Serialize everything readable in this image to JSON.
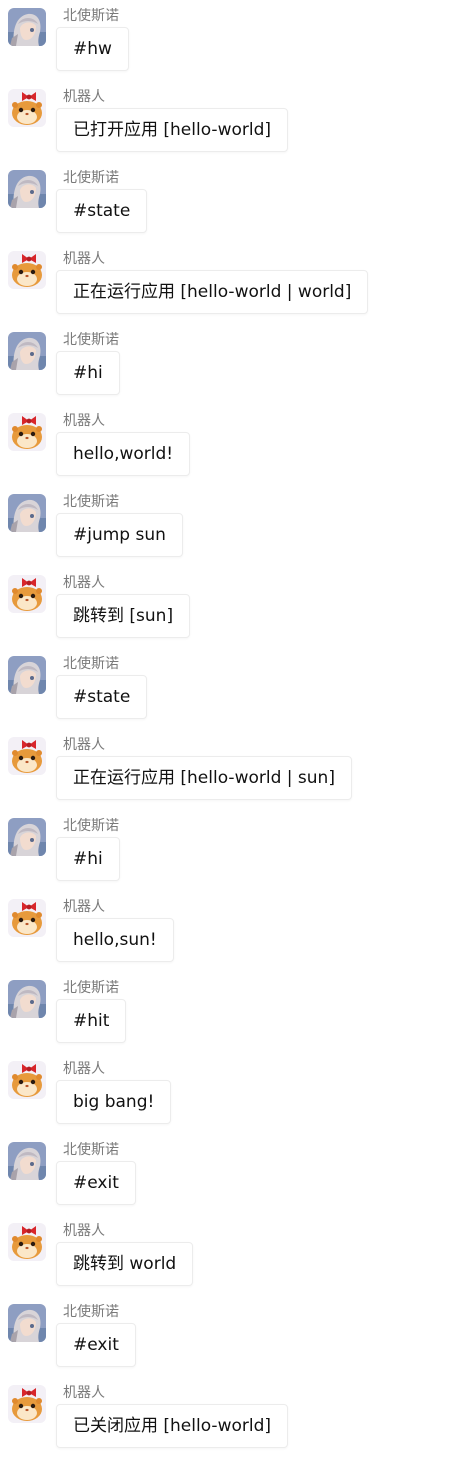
{
  "users": {
    "user": {
      "name": "北使斯诺",
      "avatar_icon": "anime-girl-avatar-icon"
    },
    "bot": {
      "name": "机器人",
      "avatar_icon": "hamster-avatar-icon"
    }
  },
  "messages": [
    {
      "sender": "user",
      "text": "#hw"
    },
    {
      "sender": "bot",
      "text": "已打开应用 [hello-world]"
    },
    {
      "sender": "user",
      "text": "#state"
    },
    {
      "sender": "bot",
      "text": "正在运行应用 [hello-world | world]"
    },
    {
      "sender": "user",
      "text": "#hi"
    },
    {
      "sender": "bot",
      "text": "hello,world!"
    },
    {
      "sender": "user",
      "text": "#jump sun"
    },
    {
      "sender": "bot",
      "text": "跳转到 [sun]"
    },
    {
      "sender": "user",
      "text": "#state"
    },
    {
      "sender": "bot",
      "text": "正在运行应用 [hello-world | sun]"
    },
    {
      "sender": "user",
      "text": "#hi"
    },
    {
      "sender": "bot",
      "text": "hello,sun!"
    },
    {
      "sender": "user",
      "text": "#hit"
    },
    {
      "sender": "bot",
      "text": "big bang!"
    },
    {
      "sender": "user",
      "text": "#exit"
    },
    {
      "sender": "bot",
      "text": "跳转到 world"
    },
    {
      "sender": "user",
      "text": "#exit"
    },
    {
      "sender": "bot",
      "text": "已关闭应用 [hello-world]"
    }
  ]
}
